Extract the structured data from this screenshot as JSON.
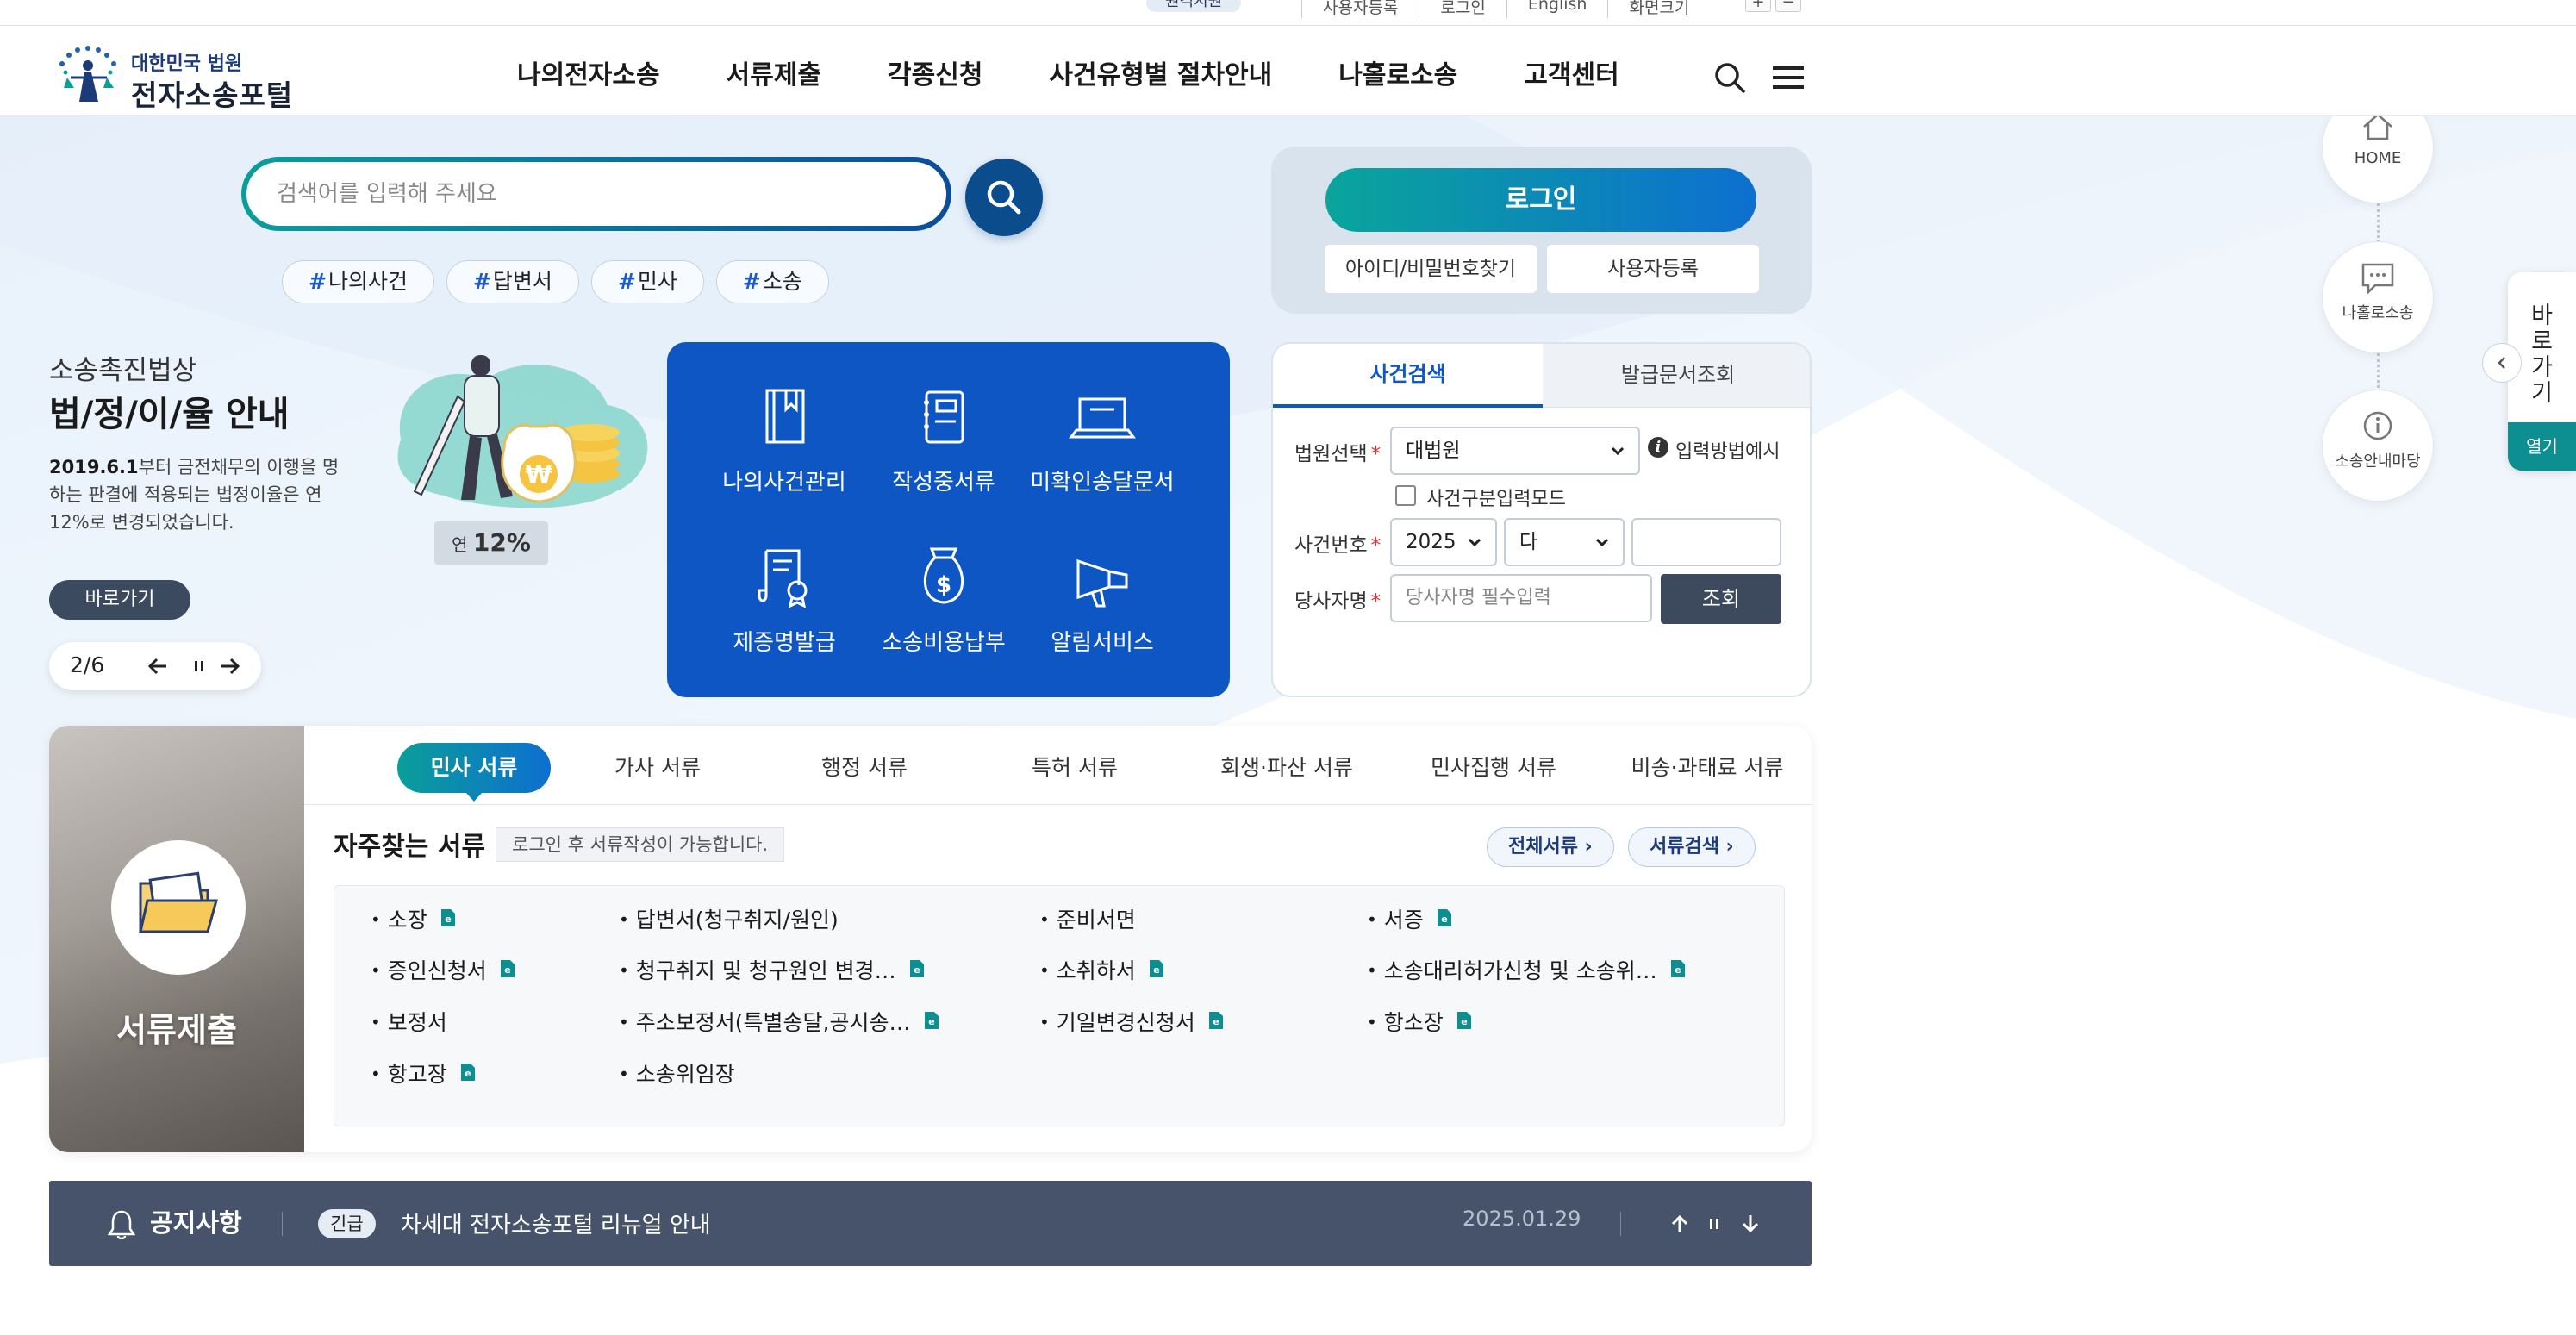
{
  "util": {
    "badge": "원격지원",
    "links": [
      "사용자등록",
      "로그인",
      "English",
      "화면크기"
    ],
    "zoom_in": "+",
    "zoom_out": "−"
  },
  "header": {
    "logo_top": "대한민국 법원",
    "logo_main": "전자소송포털",
    "nav": [
      "나의전자소송",
      "서류제출",
      "각종신청",
      "사건유형별 절차안내",
      "나홀로소송",
      "고객센터"
    ]
  },
  "search": {
    "placeholder": "검색어를 입력해 주세요",
    "tags": [
      "나의사건",
      "답변서",
      "민사",
      "소송"
    ]
  },
  "login": {
    "button": "로그인",
    "find_id": "아이디/비밀번호찾기",
    "register": "사용자등록"
  },
  "promo": {
    "caption": "소송촉진법상",
    "title": "법/정/이/율 안내",
    "body_bold": "2019.6.1",
    "body_rest": "부터 금전채무의 이행을 명하는 판결에 적용되는 법정이율은 연12%로 변경되었습니다.",
    "rate_prefix": "연",
    "rate_value": "12%",
    "go_button": "바로가기",
    "slide_counter": "2/6"
  },
  "quick_menu": {
    "items": [
      {
        "label": "나의사건관리",
        "icon": "book-icon"
      },
      {
        "label": "작성중서류",
        "icon": "notebook-icon"
      },
      {
        "label": "미확인송달문서",
        "icon": "laptop-icon"
      },
      {
        "label": "제증명발급",
        "icon": "certificate-scroll-icon"
      },
      {
        "label": "소송비용납부",
        "icon": "money-bag-icon"
      },
      {
        "label": "알림서비스",
        "icon": "megaphone-icon"
      }
    ]
  },
  "case_search": {
    "tab_active": "사건검색",
    "tab_other": "발급문서조회",
    "court_label": "법원선택",
    "court_value": "대법원",
    "input_example": "입력방법예시",
    "mode_checkbox": "사건구분입력모드",
    "case_no_label": "사건번호",
    "year_value": "2025",
    "type_value": "다",
    "party_label": "당사자명",
    "party_placeholder": "당사자명 필수입력",
    "search_button": "조회",
    "required_mark": "*"
  },
  "floating": {
    "home": "HOME",
    "self": "나홀로소송",
    "guide": "소송안내마당",
    "quick_link": "바로가기",
    "open": "열기"
  },
  "documents": {
    "panel_label": "서류제출",
    "tabs": [
      "민사 서류",
      "가사 서류",
      "행정 서류",
      "특허 서류",
      "회생·파산 서류",
      "민사집행 서류",
      "비송·과태료 서류"
    ],
    "heading": "자주찾는 서류",
    "note": "로그인 후 서류작성이 가능합니다.",
    "all_docs": "전체서류",
    "doc_search": "서류검색",
    "items": [
      {
        "label": "소장",
        "edoc": true
      },
      {
        "label": "답변서(청구취지/원인)",
        "edoc": false
      },
      {
        "label": "준비서면",
        "edoc": false
      },
      {
        "label": "서증",
        "edoc": true
      },
      {
        "label": "증인신청서",
        "edoc": true
      },
      {
        "label": "청구취지 및 청구원인 변경…",
        "edoc": true
      },
      {
        "label": "소취하서",
        "edoc": true
      },
      {
        "label": "소송대리허가신청 및 소송위…",
        "edoc": true
      },
      {
        "label": "보정서",
        "edoc": false
      },
      {
        "label": "주소보정서(특별송달,공시송…",
        "edoc": true
      },
      {
        "label": "기일변경신청서",
        "edoc": true
      },
      {
        "label": "항소장",
        "edoc": true
      },
      {
        "label": "항고장",
        "edoc": true
      },
      {
        "label": "소송위임장",
        "edoc": false
      }
    ]
  },
  "notice": {
    "title": "공지사항",
    "badge": "긴급",
    "message": "차세대 전자소송포털 리뉴얼 안내",
    "date": "2025.01.29"
  }
}
